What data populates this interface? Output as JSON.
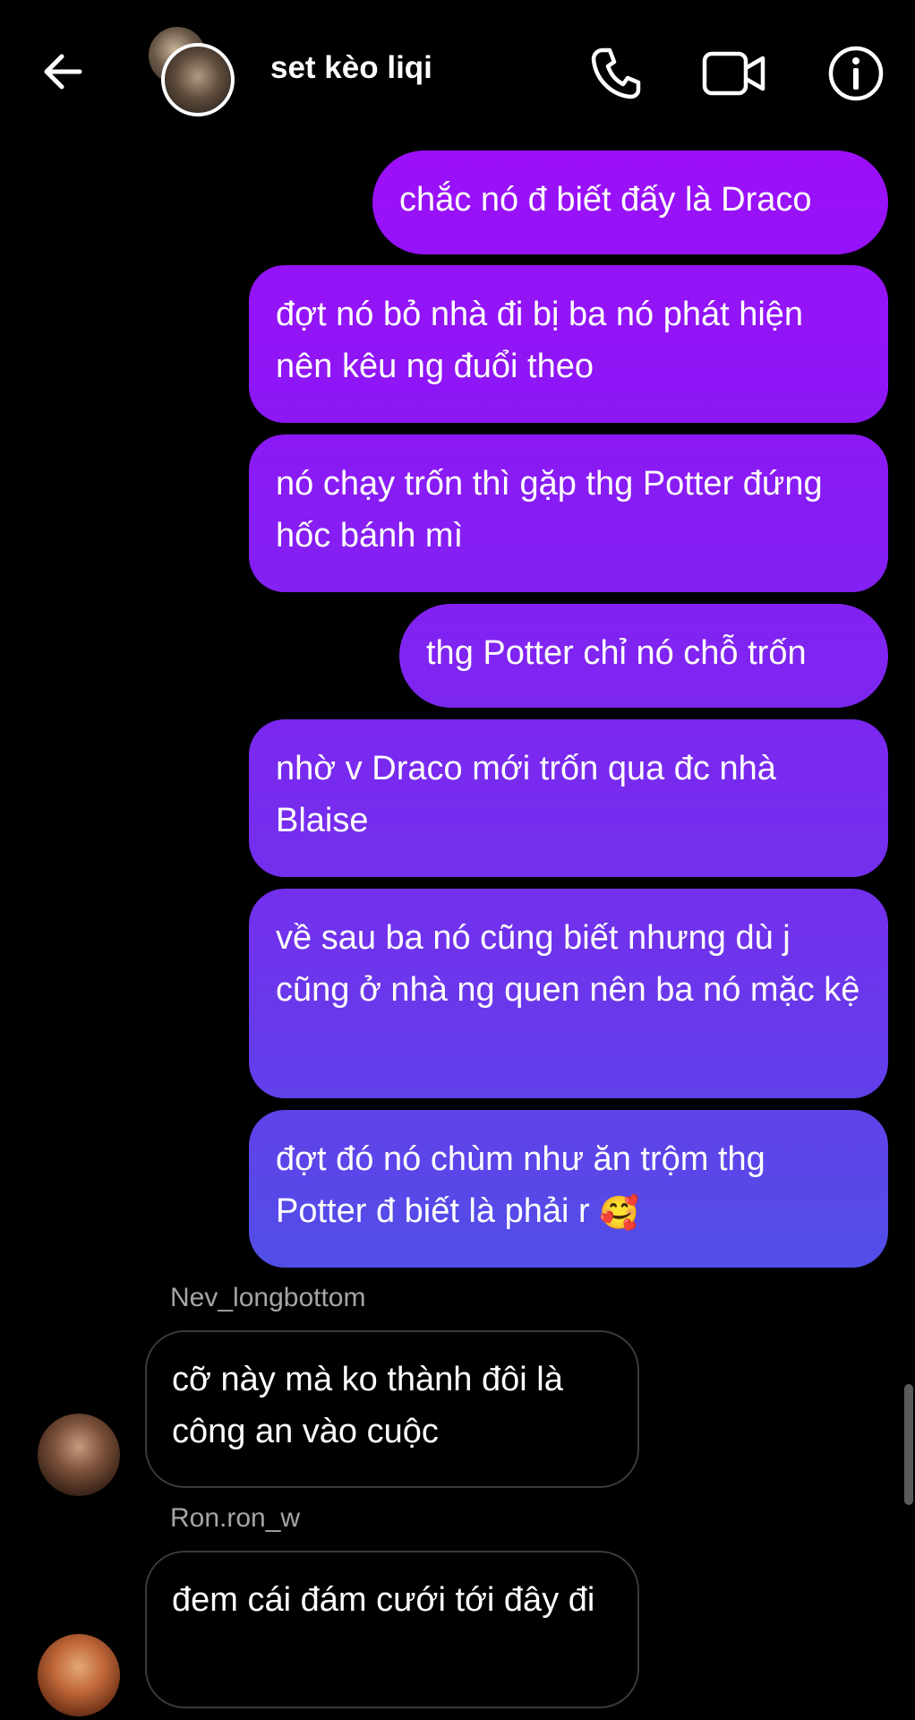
{
  "header": {
    "title": "set kèo liqi",
    "back_icon": "arrow-left-icon",
    "call_icon": "phone-icon",
    "video_icon": "video-camera-icon",
    "info_icon": "info-icon"
  },
  "messages": {
    "m1": "chắc nó đ biết đấy là Draco",
    "m2": "đợt nó bỏ nhà đi bị ba nó phát hiện nên kêu ng đuổi theo",
    "m3": "nó chạy trốn thì gặp thg Potter đứng hốc bánh mì",
    "m4": "thg Potter chỉ nó chỗ trốn",
    "m5": "nhờ v Draco mới trốn qua đc nhà Blaise",
    "m6": "về sau ba nó cũng biết nhưng dù j cũng ở nhà ng quen nên ba nó mặc kệ",
    "m7": "đợt đó nó chùm như ăn trộm thg Potter đ biết là phải r",
    "m7_emoji": "🥰",
    "nev_name": "Nev_longbottom",
    "nev_msg": "cỡ này mà ko thành đôi là công an vào cuộc",
    "ron_name": "Ron.ron_w",
    "ron_msg": "đem cái đám cưới tới đây đi"
  },
  "colors": {
    "background": "#000000",
    "outgoing_top": "#a40cfb",
    "outgoing_bottom": "#3c63e6",
    "incoming_border": "#3a3a3a",
    "sender_name": "#a5a5a5"
  }
}
